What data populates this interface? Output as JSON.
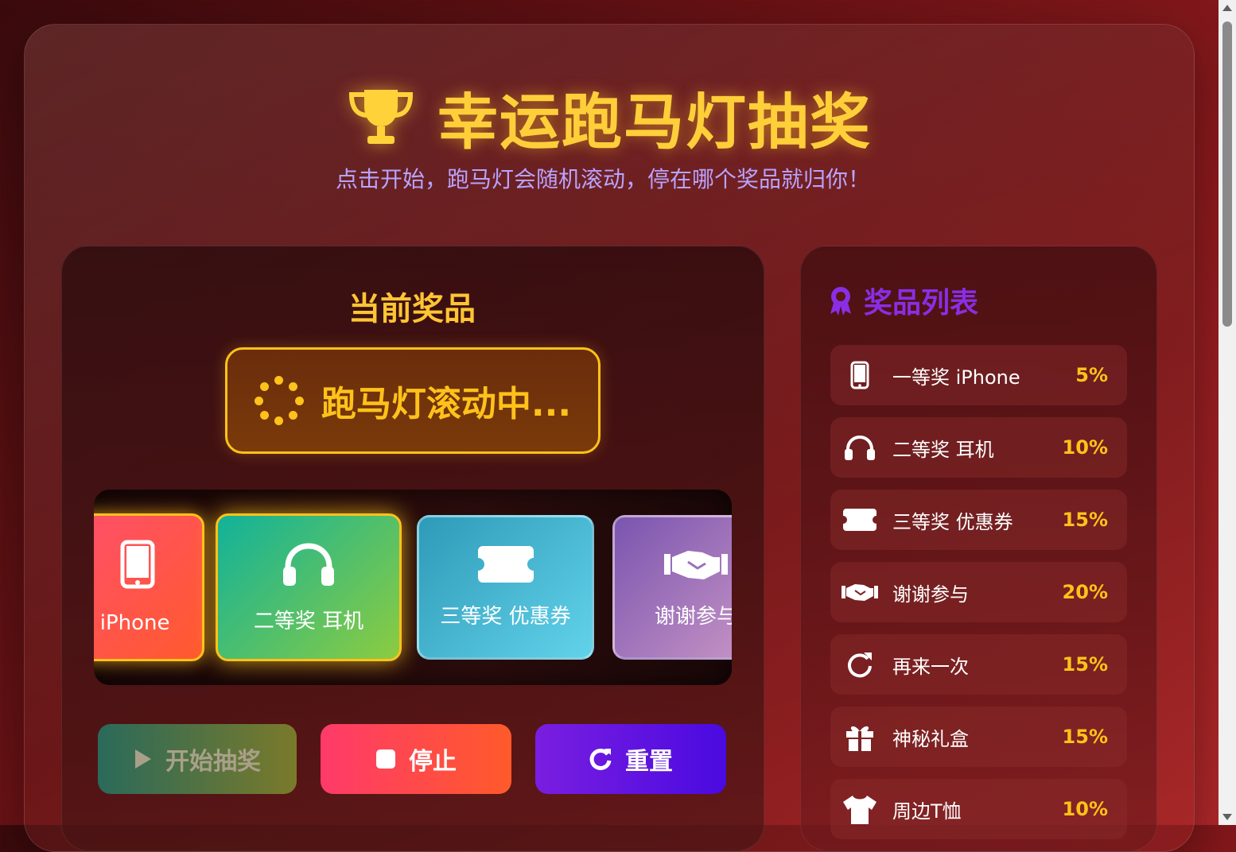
{
  "header": {
    "title": "幸运跑马灯抽奖",
    "subtitle": "点击开始，跑马灯会随机滚动，停在哪个奖品就归你！",
    "title_icon": "trophy-icon"
  },
  "current_prize": {
    "label": "当前奖品",
    "status_text": "跑马灯滚动中...",
    "status_icon": "spinner-icon"
  },
  "marquee": {
    "tiles": [
      {
        "label": "奖 iPhone",
        "icon": "phone-icon"
      },
      {
        "label": "二等奖 耳机",
        "icon": "headphones-icon"
      },
      {
        "label": "三等奖 优惠券",
        "icon": "ticket-icon"
      },
      {
        "label": "谢谢参与",
        "icon": "handshake-icon"
      }
    ]
  },
  "controls": {
    "start_label": "开始抽奖",
    "stop_label": "停止",
    "reset_label": "重置"
  },
  "prize_list": {
    "title": "奖品列表",
    "title_icon": "award-icon",
    "items": [
      {
        "name": "一等奖 iPhone",
        "pct": "5%",
        "icon": "phone-icon"
      },
      {
        "name": "二等奖 耳机",
        "pct": "10%",
        "icon": "headphones-icon"
      },
      {
        "name": "三等奖 优惠券",
        "pct": "15%",
        "icon": "ticket-icon"
      },
      {
        "name": "谢谢参与",
        "pct": "20%",
        "icon": "handshake-icon"
      },
      {
        "name": "再来一次",
        "pct": "15%",
        "icon": "redo-icon"
      },
      {
        "name": "神秘礼盒",
        "pct": "15%",
        "icon": "gift-icon"
      },
      {
        "name": "周边T恤",
        "pct": "10%",
        "icon": "tshirt-icon"
      }
    ]
  },
  "colors": {
    "accent_gold": "#ffc21a",
    "accent_purple": "#8a2ee6",
    "subtitle_lavender": "#b9a3ff"
  }
}
